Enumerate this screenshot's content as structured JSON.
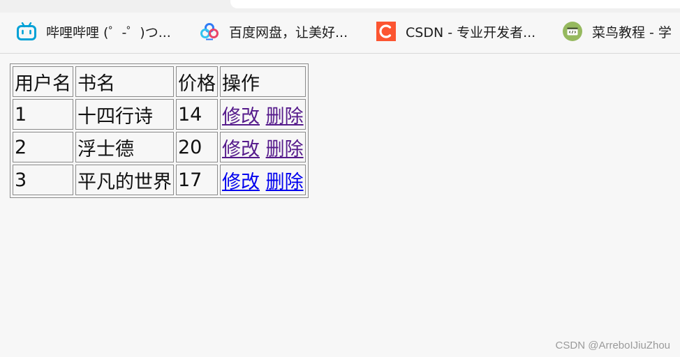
{
  "bookmarks": [
    {
      "label": "哔哩哔哩 (゜-゜)つ...",
      "icon": "bilibili-icon",
      "color": "#00a1d6"
    },
    {
      "label": "百度网盘，让美好...",
      "icon": "baidu-netdisk-icon",
      "color": "#2f7bf6"
    },
    {
      "label": "CSDN - 专业开发者...",
      "icon": "csdn-icon",
      "color": "#fc5531"
    },
    {
      "label": "菜鸟教程 - 学",
      "icon": "runoob-icon",
      "color": "#96b95f"
    }
  ],
  "table": {
    "headers": [
      "用户名",
      "书名",
      "价格",
      "操作"
    ],
    "rows": [
      {
        "user": "1",
        "book": "十四行诗",
        "price": "14",
        "edit": "修改",
        "delete": "删除"
      },
      {
        "user": "2",
        "book": "浮士德",
        "price": "20",
        "edit": "修改",
        "delete": "删除"
      },
      {
        "user": "3",
        "book": "平凡的世界",
        "price": "17",
        "edit": "修改",
        "delete": "删除"
      }
    ]
  },
  "watermark": "CSDN @ArreboIJiuZhou"
}
